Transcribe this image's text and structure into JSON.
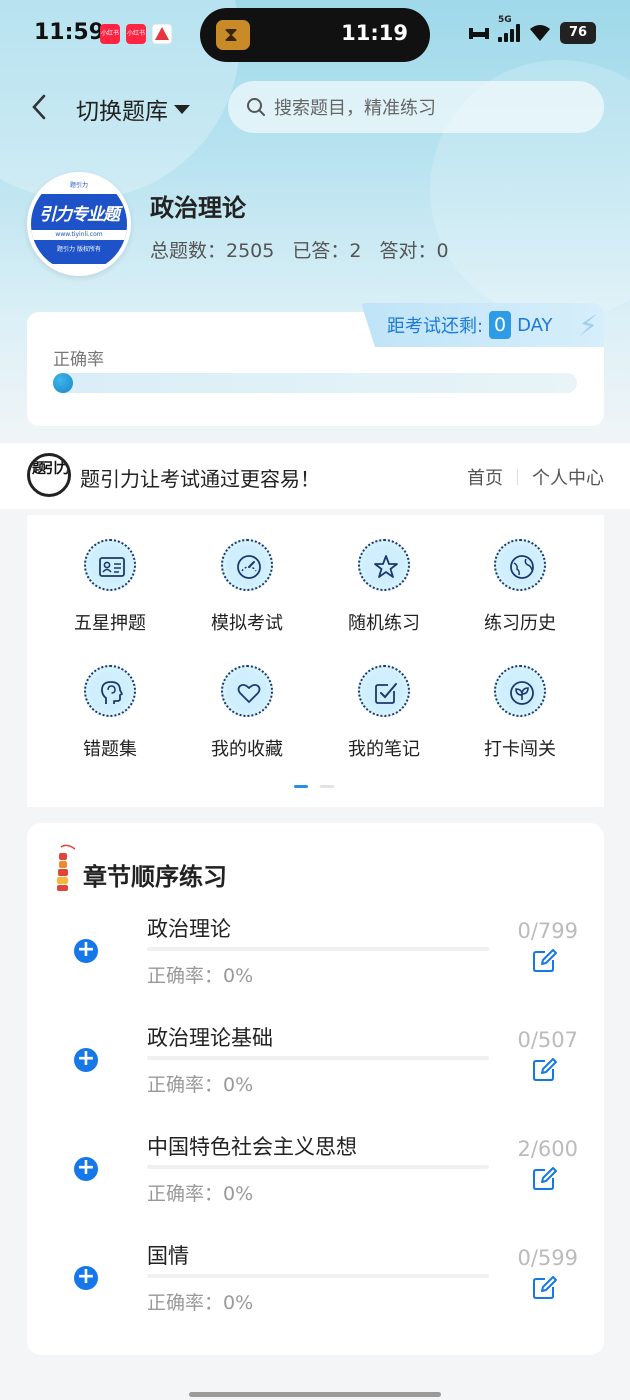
{
  "status_bar": {
    "time": "11:59",
    "badge1": "小红书",
    "badge2": "小红书",
    "island_time": "11:19",
    "network": "5G",
    "battery": "76"
  },
  "nav": {
    "switch_label": "切换题库",
    "search_placeholder": "搜索题目，精准练习"
  },
  "subject": {
    "logo_text": "引力专业题",
    "logo_url": "www.tiyinli.com",
    "logo_sub": "题引力 版权所有",
    "logo_top": "题引力",
    "title": "政治理论",
    "total_label": "总题数：2505",
    "answered_label": "已答：2",
    "correct_label": "答对：0"
  },
  "accuracy": {
    "countdown_label": "距考试还剩:",
    "countdown_days": "0",
    "countdown_unit": "DAY",
    "label": "正确率",
    "value_fraction": 0
  },
  "banner": {
    "logo_text": "题引力",
    "slogan": "题引力让考试通过更容易！",
    "link_home": "首页",
    "link_profile": "个人中心"
  },
  "functions": [
    {
      "label": "五星押题",
      "icon": "id-card-icon"
    },
    {
      "label": "模拟考试",
      "icon": "speedometer-icon"
    },
    {
      "label": "随机练习",
      "icon": "random-star-icon"
    },
    {
      "label": "练习历史",
      "icon": "globe-history-icon"
    },
    {
      "label": "错题集",
      "icon": "head-brain-icon"
    },
    {
      "label": "我的收藏",
      "icon": "heart-icon"
    },
    {
      "label": "我的笔记",
      "icon": "note-check-icon"
    },
    {
      "label": "打卡闯关",
      "icon": "sprout-icon"
    }
  ],
  "chapters": {
    "title": "章节顺序练习",
    "items": [
      {
        "name": "政治理论",
        "accuracy": "正确率：0%",
        "count": "0/799"
      },
      {
        "name": "政治理论基础",
        "accuracy": "正确率：0%",
        "count": "0/507"
      },
      {
        "name": "中国特色社会主义思想",
        "accuracy": "正确率：0%",
        "count": "2/600"
      },
      {
        "name": "国情",
        "accuracy": "正确率：0%",
        "count": "0/599"
      }
    ]
  },
  "colors": {
    "accent": "#1677e8",
    "hero_gradient_top": "#9fd9ea",
    "countdown_text": "#1d7ad8"
  }
}
